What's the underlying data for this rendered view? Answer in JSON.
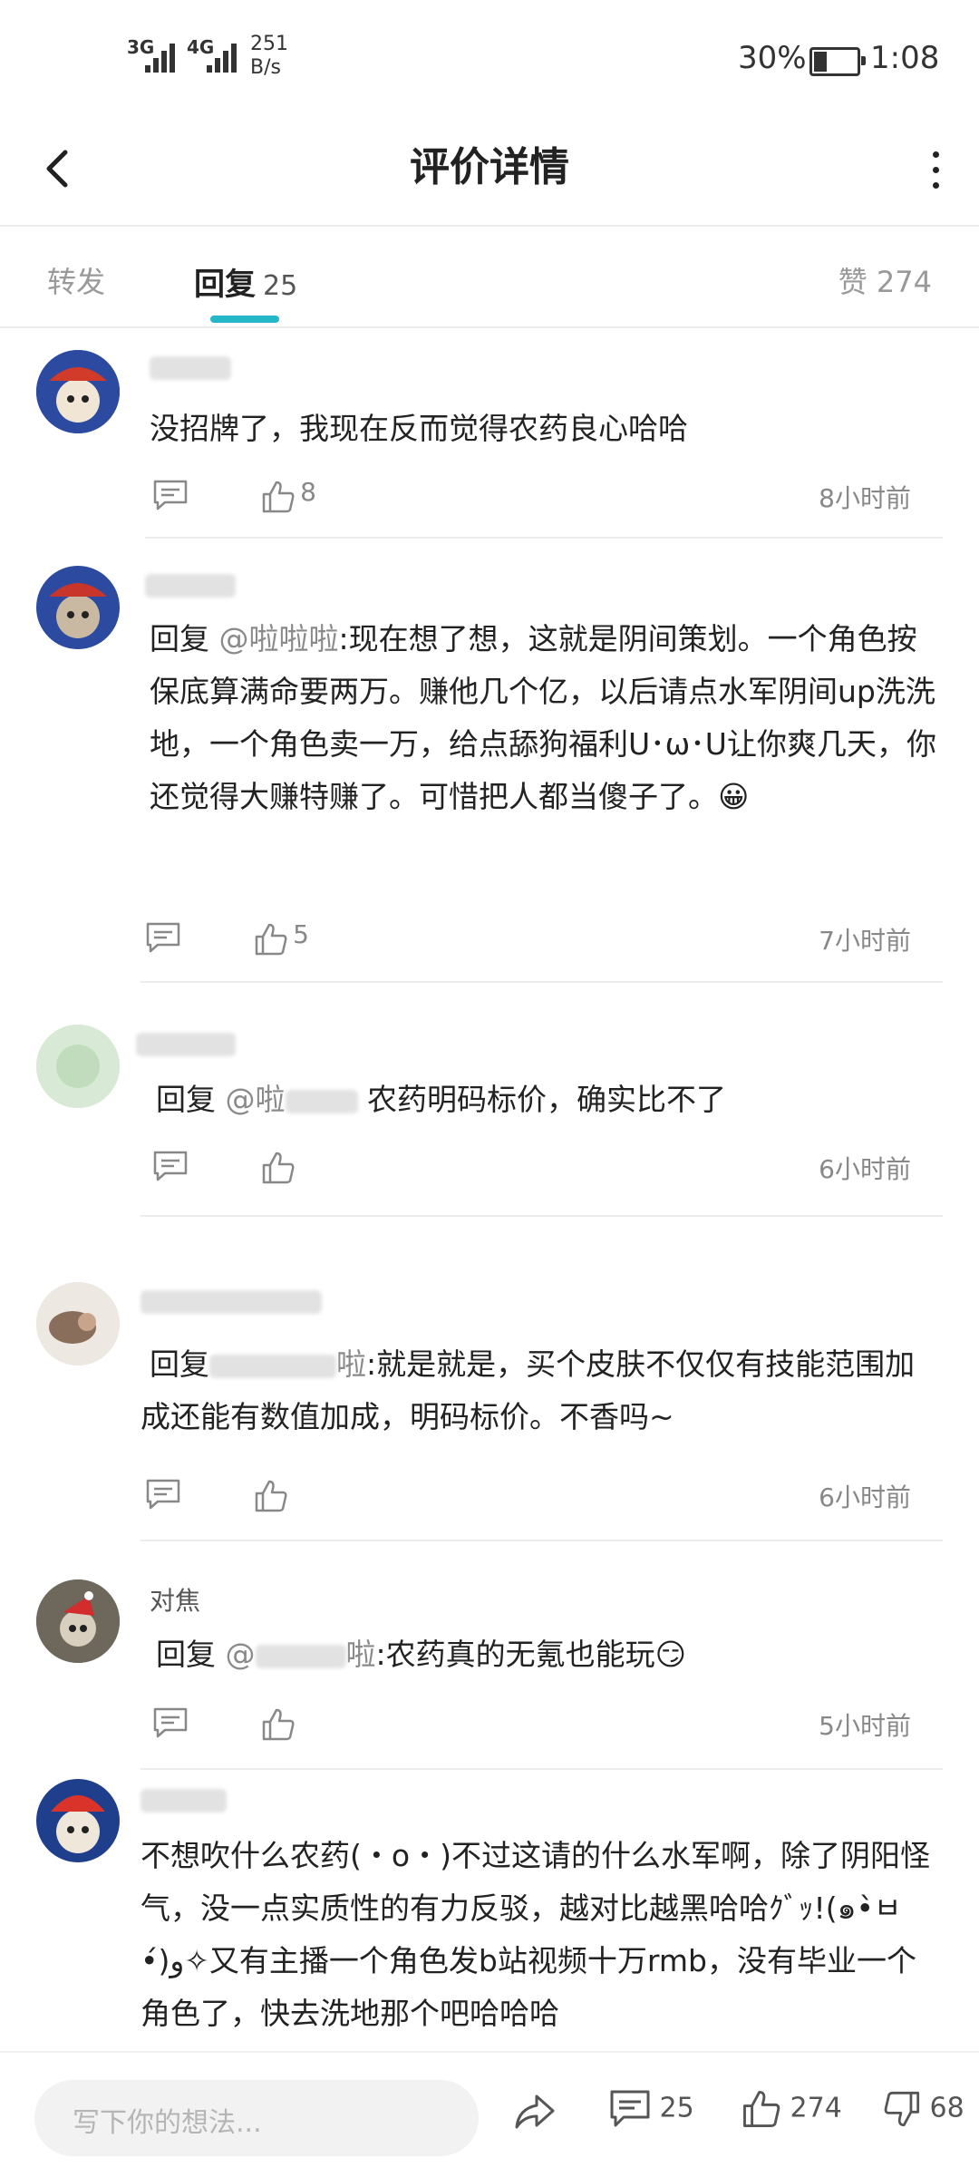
{
  "status_bar": {
    "signal_1": "3G",
    "signal_2": "4G",
    "net_speed_value": "251",
    "net_speed_unit": "B/s",
    "battery_percent": "30%",
    "battery_level": 0.3,
    "time": "1:08"
  },
  "header": {
    "title": "评价详情",
    "back_icon": "chevron-left-icon",
    "more_icon": "more-vertical-icon"
  },
  "tabs": {
    "forward_label": "转发",
    "reply_label": "回复",
    "reply_count": "25",
    "likes_label": "赞",
    "likes_count": "274"
  },
  "comments": [
    {
      "text": "没招牌了，我现在反而觉得农药良心哈哈",
      "likes": "8",
      "time": "8小时前"
    },
    {
      "reply_prefix": "回复",
      "mention": "@啦啦啦",
      "text": ":现在想了想，这就是阴间策划。一个角色按保底算满命要两万。赚他几个亿，以后请点水军阴间up洗洗地，一个角色卖一万，给点舔狗福利U･ω･U让你爽几天，你还觉得大赚特赚了。可惜把人都当傻子了。😀",
      "likes": "5",
      "time": "7小时前"
    },
    {
      "reply_prefix": "回复",
      "mention": "@啦",
      "text": "农药明码标价，确实比不了",
      "likes": "",
      "time": "6小时前"
    },
    {
      "reply_prefix": "回复",
      "mention": "啦",
      "text": ":就是就是，买个皮肤不仅仅有技能范围加成还能有数值加成，明码标价。不香吗~",
      "likes": "",
      "time": "6小时前"
    },
    {
      "username": "对焦",
      "reply_prefix": "回复",
      "mention": "@",
      "mention_tail": "啦",
      "text": ":农药真的无氪也能玩😏",
      "likes": "",
      "time": "5小时前"
    },
    {
      "text": "不想吹什么农药(・o・)不过这请的什么水军啊，除了阴阳怪气，没一点实质性的有力反驳，越对比越黑哈哈ｸﾞｯ!(๑•̀ㅂ•́)و✧又有主播一个角色发b站视频十万rmb，没有毕业一个角色了，快去洗地那个吧哈哈哈"
    }
  ],
  "bottom_bar": {
    "input_placeholder": "写下你的想法...",
    "share_icon": "share-icon",
    "comment_count": "25",
    "like_count": "274",
    "dislike_count": "68"
  },
  "colors": {
    "accent": "#25b7c9",
    "muted": "#888888",
    "text": "#222222"
  }
}
